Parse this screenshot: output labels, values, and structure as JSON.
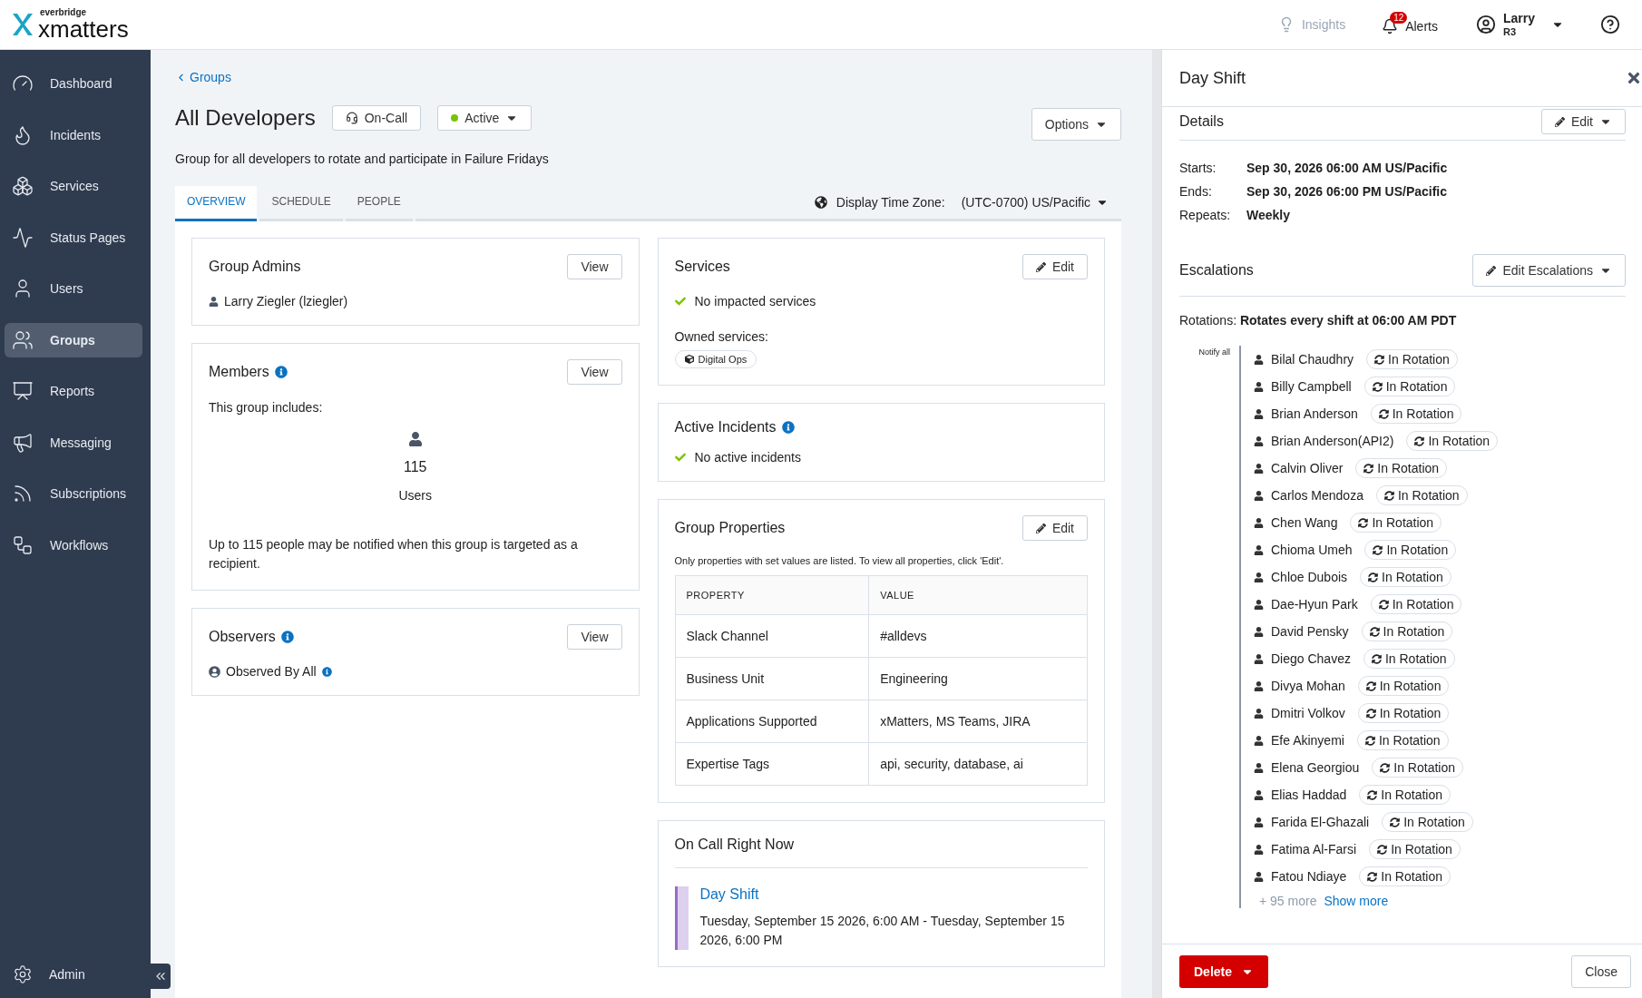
{
  "header": {
    "brand_top": "everbridge",
    "brand": "xmatters",
    "insights": "Insights",
    "alerts": {
      "label": "Alerts",
      "count": "12"
    },
    "user": {
      "name": "Larry",
      "sub": "R3"
    }
  },
  "sidebar": {
    "items": [
      {
        "label": "Dashboard",
        "selected": false
      },
      {
        "label": "Incidents",
        "selected": false
      },
      {
        "label": "Services",
        "selected": false
      },
      {
        "label": "Status Pages",
        "selected": false
      },
      {
        "label": "Users",
        "selected": false
      },
      {
        "label": "Groups",
        "selected": true
      },
      {
        "label": "Reports",
        "selected": false
      },
      {
        "label": "Messaging",
        "selected": false
      },
      {
        "label": "Subscriptions",
        "selected": false
      },
      {
        "label": "Workflows",
        "selected": false
      }
    ],
    "admin": "Admin"
  },
  "breadcrumb": "Groups",
  "group": {
    "title": "All Developers",
    "on_call": "On-Call",
    "status": "Active",
    "description": "Group for all developers to rotate and participate in Failure Fridays",
    "options": "Options"
  },
  "tabs": [
    {
      "label": "OVERVIEW",
      "selected": true
    },
    {
      "label": "SCHEDULE",
      "selected": false
    },
    {
      "label": "PEOPLE",
      "selected": false
    }
  ],
  "timezone": {
    "label": "Display Time Zone:",
    "value": "(UTC-0700) US/Pacific"
  },
  "group_admins": {
    "title": "Group Admins",
    "button": "View",
    "admin": "Larry Ziegler (lziegler)"
  },
  "members": {
    "title": "Members",
    "button": "View",
    "intro": "This group includes:",
    "count": "115",
    "unit": "Users",
    "note": "Up to 115 people may be notified when this group is targeted as a recipient."
  },
  "observers": {
    "title": "Observers",
    "button": "View",
    "value": "Observed By All"
  },
  "services": {
    "title": "Services",
    "button": "Edit",
    "status": "No impacted services",
    "owned_label": "Owned services:",
    "owned": [
      "Digital Ops"
    ]
  },
  "active_incidents": {
    "title": "Active Incidents",
    "status": "No active incidents"
  },
  "group_properties": {
    "title": "Group Properties",
    "button": "Edit",
    "note": "Only properties with set values are listed. To view all properties, click 'Edit'.",
    "columns": [
      "PROPERTY",
      "VALUE"
    ],
    "rows": [
      [
        "Slack Channel",
        "#alldevs"
      ],
      [
        "Business Unit",
        "Engineering"
      ],
      [
        "Applications Supported",
        "xMatters, MS Teams, JIRA"
      ],
      [
        "Expertise Tags",
        "api, security, database, ai"
      ]
    ]
  },
  "on_call": {
    "title": "On Call Right Now",
    "shift": {
      "name": "Day Shift",
      "time": "Tuesday, September 15 2026, 6:00 AM - Tuesday, September 15 2026, 6:00 PM"
    }
  },
  "panel": {
    "title": "Day Shift",
    "details": {
      "title": "Details",
      "button": "Edit",
      "fields": [
        {
          "label": "Starts:",
          "value": "Sep 30, 2026 06:00 AM US/Pacific"
        },
        {
          "label": "Ends:",
          "value": "Sep 30, 2026 06:00 PM US/Pacific"
        },
        {
          "label": "Repeats:",
          "value": "Weekly"
        }
      ]
    },
    "escalations": {
      "title": "Escalations",
      "button": "Edit Escalations",
      "rotation_label": "Rotations:",
      "rotation_value": "Rotates every shift at 06:00 AM PDT",
      "notify": "Notify all",
      "members": [
        {
          "name": "Bilal Chaudhry",
          "badge": "In Rotation"
        },
        {
          "name": "Billy Campbell",
          "badge": "In Rotation"
        },
        {
          "name": "Brian Anderson",
          "badge": "In Rotation"
        },
        {
          "name": "Brian Anderson(API2)",
          "badge": "In Rotation"
        },
        {
          "name": "Calvin Oliver",
          "badge": "In Rotation"
        },
        {
          "name": "Carlos Mendoza",
          "badge": "In Rotation"
        },
        {
          "name": "Chen Wang",
          "badge": "In Rotation"
        },
        {
          "name": "Chioma Umeh",
          "badge": "In Rotation"
        },
        {
          "name": "Chloe Dubois",
          "badge": "In Rotation"
        },
        {
          "name": "Dae-Hyun Park",
          "badge": "In Rotation"
        },
        {
          "name": "David Pensky",
          "badge": "In Rotation"
        },
        {
          "name": "Diego Chavez",
          "badge": "In Rotation"
        },
        {
          "name": "Divya Mohan",
          "badge": "In Rotation"
        },
        {
          "name": "Dmitri Volkov",
          "badge": "In Rotation"
        },
        {
          "name": "Efe Akinyemi",
          "badge": "In Rotation"
        },
        {
          "name": "Elena Georgiou",
          "badge": "In Rotation"
        },
        {
          "name": "Elias Haddad",
          "badge": "In Rotation"
        },
        {
          "name": "Farida El-Ghazali",
          "badge": "In Rotation"
        },
        {
          "name": "Fatima Al-Farsi",
          "badge": "In Rotation"
        },
        {
          "name": "Fatou Ndiaye",
          "badge": "In Rotation"
        }
      ],
      "more": "+ 95 more",
      "show_more": "Show more"
    },
    "delete": "Delete",
    "close": "Close"
  }
}
